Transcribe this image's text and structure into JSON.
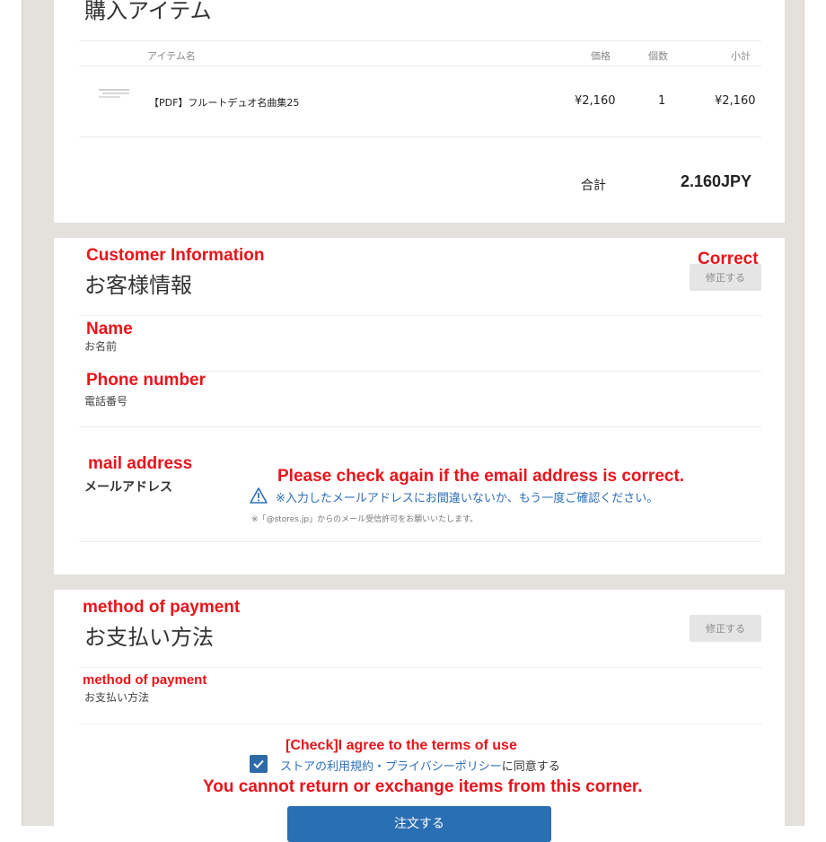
{
  "purchase": {
    "title": "購入アイテム",
    "headers": {
      "item": "アイテム名",
      "price": "価格",
      "qty": "個数",
      "subtotal": "小計"
    },
    "item": {
      "name": "【PDF】フルートデュオ名曲集25",
      "price": "¥2,160",
      "qty": "1",
      "subtotal": "¥2,160"
    },
    "total_label": "合計",
    "total_value": "2.160JPY"
  },
  "customer": {
    "annotation": "Customer Information",
    "title": "お客様情報",
    "correct_annotation": "Correct",
    "edit_button": "修正する",
    "name_annotation": "Name",
    "name_label": "お名前",
    "phone_annotation": "Phone number",
    "phone_label": "電話番号",
    "mail_annotation": "mail address",
    "mail_label": "メールアドレス",
    "mail_check_annotation": "Please check again if the email address is correct.",
    "mail_warning": "※入力したメールアドレスにお間違いないか、もう一度ご確認ください。",
    "mail_note": "※「@stores.jp」からのメール受信許可をお願いいたします。"
  },
  "payment": {
    "annotation": "method of payment",
    "title": "お支払い方法",
    "edit_button": "修正する",
    "method_annotation": "method of payment",
    "method_label": "お支払い方法",
    "check_annotation": "[Check]I agree to the terms of use",
    "agree_link": "ストアの利用規約・プライバシーポリシー",
    "agree_suffix": "に同意する",
    "warning_annotation": "You cannot return or exchange items from this corner.",
    "submit_label": "注文する"
  },
  "colors": {
    "annotation": "#e8141b",
    "link": "#2d6fb7",
    "button": "#2a6eb3",
    "frame": "#e4e0db"
  }
}
